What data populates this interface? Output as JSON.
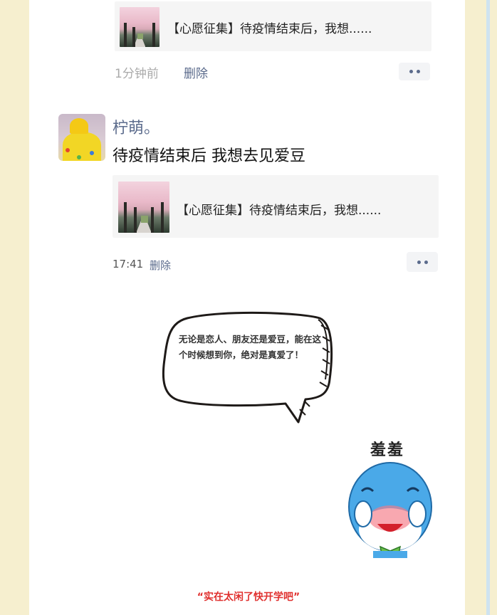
{
  "comments": [
    {
      "share_title": "【心愿征集】待疫情结束后，我想......",
      "time": "1分钟前",
      "delete_label": "删除"
    },
    {
      "user": "柠萌。",
      "text": "待疫情结束后 我想去见爱豆",
      "share_title": "【心愿征集】待疫情结束后，我想......",
      "time": "17:41",
      "delete_label": "删除"
    }
  ],
  "speech_bubble": {
    "text": "无论是恋人、朋友还是爱豆，能在这个时候想到你，绝对是真爱了！"
  },
  "sticker": {
    "label": "羞羞",
    "icon": "shy-blue-mascot"
  },
  "caption": "“实在太闲了快开学吧”",
  "colors": {
    "background": "#f6efcf",
    "link": "#5b6b8c",
    "caption": "#e0312f"
  }
}
